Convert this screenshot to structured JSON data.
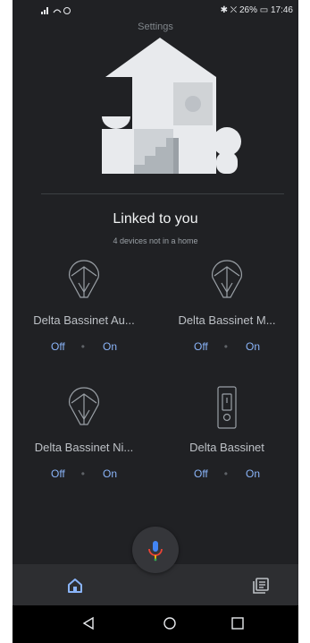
{
  "status": {
    "left_icons": "signal-wifi-alarm",
    "right_text": "✱ ⛌ 26% ▭ 17:46"
  },
  "header": {
    "peek_title": "Settings"
  },
  "linked": {
    "title": "Linked to you",
    "subtitle": "4 devices not in a home"
  },
  "devices": [
    {
      "name": "Delta Bassinet Au...",
      "icon": "bulb-icon",
      "off_label": "Off",
      "separator": "•",
      "on_label": "On"
    },
    {
      "name": "Delta Bassinet M...",
      "icon": "bulb-icon",
      "off_label": "Off",
      "separator": "•",
      "on_label": "On"
    },
    {
      "name": "Delta Bassinet Ni...",
      "icon": "bulb-icon",
      "off_label": "Off",
      "separator": "•",
      "on_label": "On"
    },
    {
      "name": "Delta Bassinet",
      "icon": "switch-icon",
      "off_label": "Off",
      "separator": "•",
      "on_label": "On"
    }
  ],
  "nav": {
    "home_icon": "home-icon",
    "feed_icon": "feed-icon",
    "mic_icon": "mic-icon"
  },
  "colors": {
    "background": "#202124",
    "accent": "#8ab4f8",
    "nav": "#2d2e31"
  }
}
